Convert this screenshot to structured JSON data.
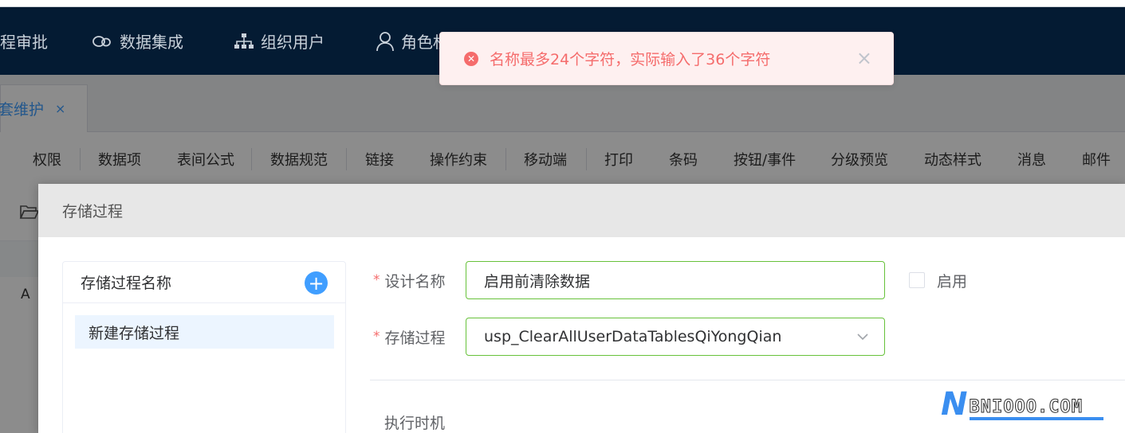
{
  "nav": {
    "items": [
      {
        "label": "程审批",
        "icon": "none"
      },
      {
        "label": "数据集成",
        "icon": "link-icon"
      },
      {
        "label": "组织用户",
        "icon": "org-chart-icon"
      },
      {
        "label": "角色权",
        "icon": "user-icon"
      }
    ]
  },
  "tabs": [
    {
      "label": "套维护",
      "close": "×"
    }
  ],
  "toolbar": {
    "items": [
      "权限",
      "数据项",
      "表间公式",
      "数据规范",
      "链接",
      "操作约束",
      "移动端",
      "打印",
      "条码",
      "按钮/事件",
      "分级预览",
      "动态样式",
      "消息",
      "邮件"
    ]
  },
  "page": {
    "column_label": "A"
  },
  "dialog": {
    "title": "存储过程",
    "left_panel": {
      "heading": "存储过程名称",
      "add_label": "+",
      "items": [
        "新建存储过程"
      ]
    },
    "form": {
      "design_name_label": "设计名称",
      "design_name_value": "启用前清除数据",
      "procedure_label": "存储过程",
      "procedure_value": "usp_ClearAllUserDataTablesQiYongQian",
      "enable_label": "启用",
      "enable_checked": false,
      "exec_timing_label": "执行时机",
      "required_mark": "*"
    }
  },
  "toast": {
    "type": "error",
    "message": "名称最多24个字符，实际输入了36个字符",
    "close": "×"
  },
  "watermark": {
    "logo_letter": "N",
    "text": "BNIOOO.COM"
  },
  "colors": {
    "nav_bg": "#041b33",
    "primary": "#409eff",
    "error": "#f56c6c",
    "success_border": "#67c23a"
  }
}
